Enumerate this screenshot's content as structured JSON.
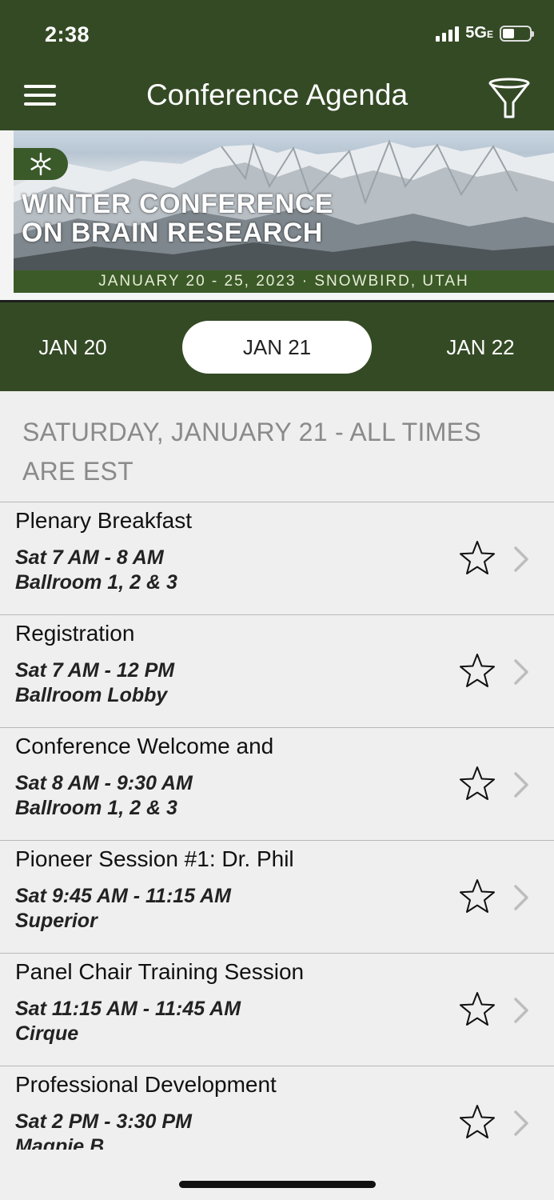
{
  "status_bar": {
    "time": "2:38",
    "network": "5G",
    "network_suffix": "E"
  },
  "header": {
    "title": "Conference Agenda"
  },
  "banner": {
    "title_line1": "WINTER CONFERENCE",
    "title_line2": "ON BRAIN RESEARCH",
    "subtitle": "JANUARY 20 - 25, 2023 · SNOWBIRD, UTAH"
  },
  "date_tabs": [
    {
      "label": "JAN 20",
      "active": false
    },
    {
      "label": "JAN 21",
      "active": true
    },
    {
      "label": "JAN 22",
      "active": false
    }
  ],
  "section_heading": "SATURDAY, JANUARY 21 - ALL TIMES ARE EST",
  "sessions": [
    {
      "title": "Plenary Breakfast",
      "time": "Sat 7 AM - 8 AM",
      "room": "Ballroom 1, 2 & 3"
    },
    {
      "title": "Registration",
      "time": "Sat 7 AM - 12 PM",
      "room": "Ballroom Lobby"
    },
    {
      "title": "Conference Welcome and",
      "time": "Sat 8 AM - 9:30 AM",
      "room": "Ballroom 1, 2 & 3"
    },
    {
      "title": "Pioneer Session #1: Dr. Phil",
      "time": "Sat 9:45 AM - 11:15 AM",
      "room": "Superior"
    },
    {
      "title": "Panel Chair Training Session",
      "time": "Sat 11:15 AM - 11:45 AM",
      "room": "Cirque"
    },
    {
      "title": "Professional Development",
      "time": "Sat 2 PM - 3:30 PM",
      "room": "Magpie B"
    }
  ],
  "icons": {
    "menu": "hamburger-menu-icon",
    "filter": "funnel-filter-icon",
    "favorite": "star-outline-icon",
    "disclosure": "chevron-right-icon",
    "logo": "snowflake-icon"
  },
  "colors": {
    "brand_green": "#344a25",
    "banner_strip": "#3c5a27",
    "list_background": "#efefef",
    "section_heading": "#8a8a8a"
  }
}
